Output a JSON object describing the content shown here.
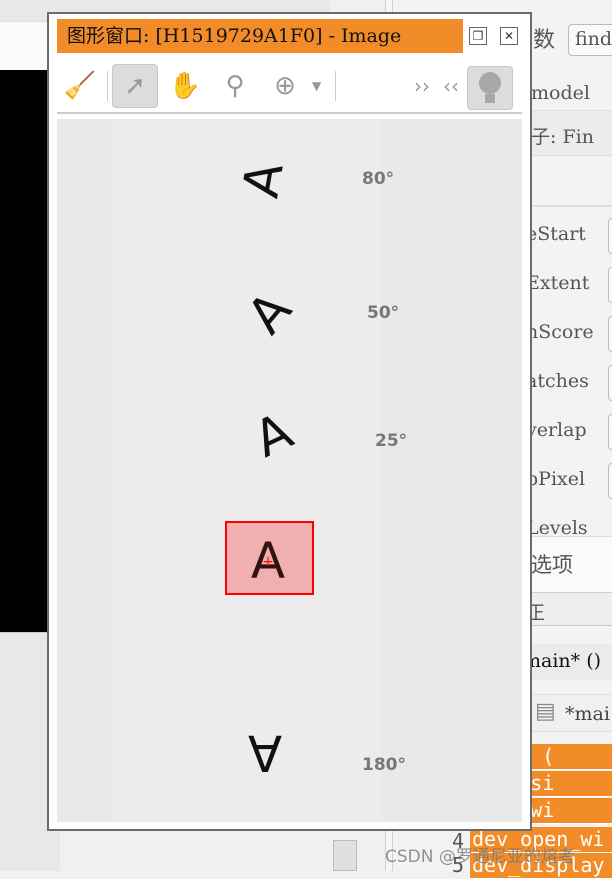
{
  "window": {
    "title": "图形窗口: [H1519729A1F0] - Image",
    "restore_icon": "restore-icon",
    "close_icon": "close-icon"
  },
  "toolbar": {
    "tools": [
      "broom-icon",
      "pointer-icon",
      "hand-icon",
      "magnifier-icon",
      "zoom-in-icon"
    ],
    "more": "››",
    "less": "‹‹"
  },
  "canvas": {
    "items": [
      {
        "glyph": "A",
        "angle": "80°"
      },
      {
        "glyph": "A",
        "angle": "50°"
      },
      {
        "glyph": "A",
        "angle": "25°"
      },
      {
        "glyph": "A",
        "angle": ""
      },
      {
        "glyph": "A",
        "angle": "180°"
      }
    ],
    "selection_color": "#ff0000"
  },
  "right_panel": {
    "top_label": "数",
    "top_input": "find",
    "model": "model",
    "operator": "子: Fin",
    "params": [
      "eStart",
      "Extent",
      "nScore",
      "atches",
      "verlap",
      "bPixel",
      "Levels"
    ],
    "options": "选项",
    "section": "正",
    "tab": "main* ()",
    "editor_tab": "*mai",
    "code_lines": [
      {
        "num": "",
        "text": "image ("
      },
      {
        "num": "",
        "text": "mage_si"
      },
      {
        "num": "",
        "text": "lose_wi"
      },
      {
        "num": "4",
        "text": "dev_open_wi"
      },
      {
        "num": "5",
        "text": "dev_display"
      }
    ]
  },
  "watermark": "CSDN @罗通尼亚的熔者",
  "accent": "#f28c28"
}
